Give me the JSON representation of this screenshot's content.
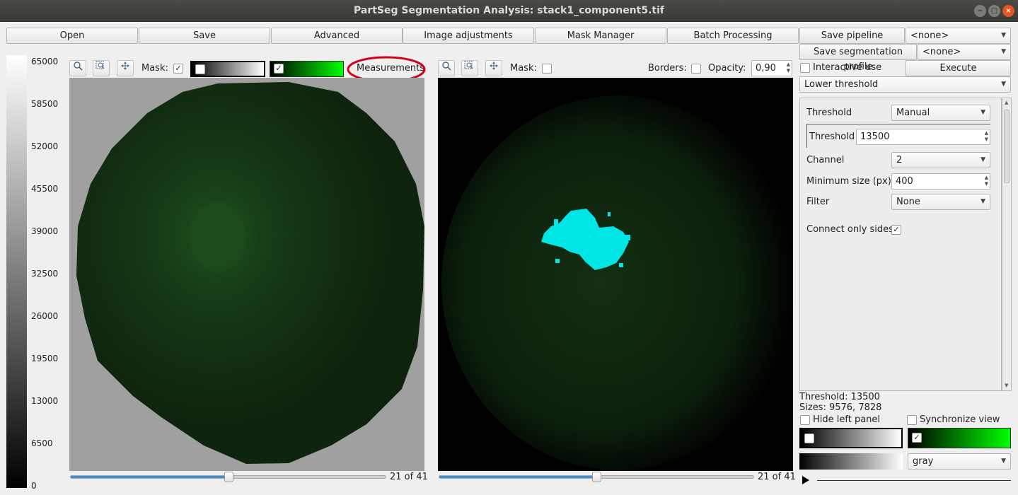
{
  "window": {
    "title": "PartSeg Segmentation Analysis: stack1_component5.tif",
    "min_glyph": "−",
    "max_glyph": "□",
    "close_glyph": "×"
  },
  "toolbar": {
    "open": "Open",
    "save": "Save",
    "advanced": "Advanced",
    "image_adjustments": "Image adjustments",
    "mask_manager": "Mask Manager",
    "batch_processing": "Batch Processing",
    "save_pipeline": "Save pipeline",
    "pipeline_select": "<none>",
    "save_profile": "Save segmentation profile",
    "profile_select": "<none>",
    "interactive_use": "Interactive use",
    "execute": "Execute",
    "algorithm_select": "Lower threshold"
  },
  "colorbar": {
    "ticks": [
      "65000",
      "58500",
      "52000",
      "45500",
      "39000",
      "32500",
      "26000",
      "19500",
      "13000",
      "6500",
      "0"
    ]
  },
  "left_view": {
    "mask_label": "Mask:",
    "mask_checked": "✓",
    "channel2_checked": "✓",
    "measurements_button": "Measurements",
    "slice_label": "21 of 41",
    "slice_fraction": 0.5,
    "accent": "#d0021b"
  },
  "right_view": {
    "mask_label": "Mask:",
    "borders_label": "Borders:",
    "opacity_label": "Opacity:",
    "opacity_value": "0,90",
    "slice_label": "21 of 41",
    "slice_fraction": 0.5,
    "segmentation_color": "#00e5e5"
  },
  "settings": {
    "threshold_mode_label": "Threshold",
    "threshold_mode": "Manual",
    "threshold_label": "Threshold",
    "threshold_value": "13500",
    "channel_label": "Channel",
    "channel_value": "2",
    "min_size_label": "Minimum size (px)",
    "min_size_value": "400",
    "filter_label": "Filter",
    "filter_value": "None",
    "connect_label": "Connect only sides",
    "connect_checked": "✓"
  },
  "info": {
    "threshold_text": "Threshold: 13500",
    "sizes_text": "Sizes: 9576, 7828"
  },
  "bottom": {
    "hide_left_panel": "Hide left panel",
    "synchronize_view": "Synchronize view",
    "colormap_select": "gray",
    "channel2_checked": "✓",
    "play_icon": "play-icon"
  },
  "icons": {
    "zoom": "zoom-icon",
    "zoom_box": "zoom-box-icon",
    "move": "move-icon"
  }
}
